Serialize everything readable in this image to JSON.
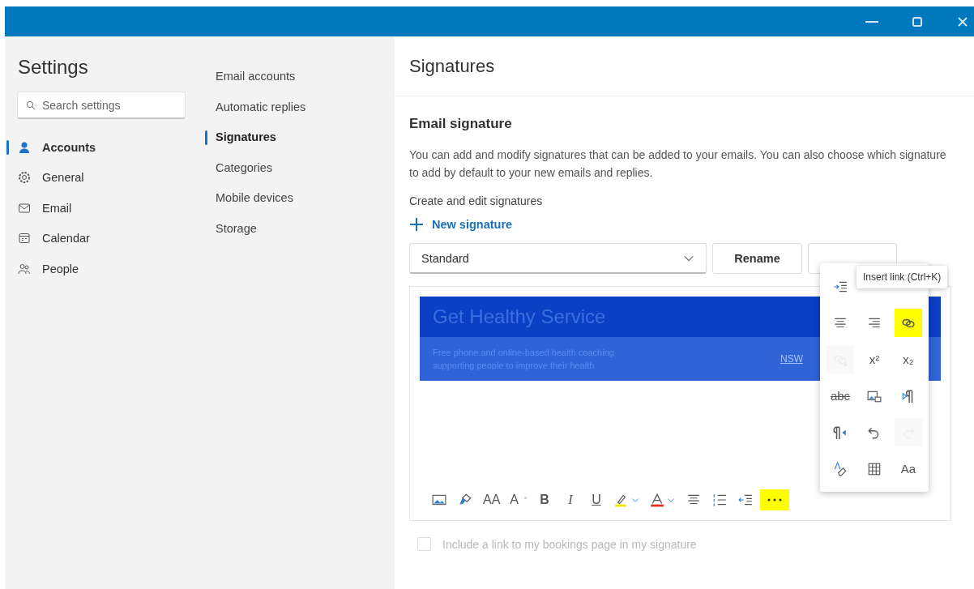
{
  "window": {
    "controls": [
      {
        "kind": "minimize"
      },
      {
        "kind": "maximize"
      },
      {
        "kind": "close"
      }
    ]
  },
  "settings": {
    "title": "Settings",
    "search": {
      "placeholder": "Search settings"
    },
    "nav": [
      {
        "label": "Accounts",
        "kind": "person",
        "selected": true
      },
      {
        "label": "General",
        "kind": "gear",
        "selected": false
      },
      {
        "label": "Email",
        "kind": "mail",
        "selected": false
      },
      {
        "label": "Calendar",
        "kind": "calendar",
        "selected": false
      },
      {
        "label": "People",
        "kind": "people",
        "selected": false
      }
    ]
  },
  "subnav": [
    {
      "label": "Email accounts",
      "selected": false
    },
    {
      "label": "Automatic replies",
      "selected": false
    },
    {
      "label": "Signatures",
      "selected": true
    },
    {
      "label": "Categories",
      "selected": false
    },
    {
      "label": "Mobile devices",
      "selected": false
    },
    {
      "label": "Storage",
      "selected": false
    }
  ],
  "content": {
    "title": "Signatures",
    "section": "Email signature",
    "description": "You can add and modify signatures that can be added to your emails. You can also choose which signature to add by default to your new emails and replies.",
    "create_label": "Create and edit signatures",
    "new_button": "New signature",
    "signature_select": {
      "value": "Standard"
    },
    "rename_button": "Rename",
    "banner": {
      "title": "Get Healthy Service",
      "subtitle": "Free phone and online-based health coaching supporting people to improve their health",
      "logo": "NSW"
    },
    "toolbar": [
      {
        "kind": "image",
        "highlighted": false
      },
      {
        "kind": "painter",
        "highlighted": false
      },
      {
        "kind": "text",
        "label": "AA",
        "highlighted": false
      },
      {
        "kind": "grow",
        "label": "A",
        "highlighted": false
      },
      {
        "kind": "bold",
        "label": "B",
        "highlighted": false
      },
      {
        "kind": "italic",
        "label": "I",
        "highlighted": false
      },
      {
        "kind": "underline",
        "label": "U",
        "highlighted": false
      },
      {
        "kind": "highlight",
        "highlighted": false
      },
      {
        "kind": "fontcolor",
        "highlighted": false
      },
      {
        "kind": "bullets",
        "highlighted": false
      },
      {
        "kind": "numbers",
        "highlighted": false
      },
      {
        "kind": "outdent",
        "highlighted": false
      },
      {
        "kind": "more",
        "highlighted": true
      }
    ],
    "bookings": {
      "label": "Include a link to my bookings page in my signature",
      "checked": false,
      "disabled": true
    }
  },
  "more_menu": {
    "items": [
      {
        "kind": "indent",
        "highlighted": false,
        "disabled": false
      },
      {
        "kind": "blank"
      },
      {
        "kind": "blank"
      },
      {
        "kind": "center",
        "highlighted": false,
        "disabled": false
      },
      {
        "kind": "right",
        "highlighted": false,
        "disabled": false
      },
      {
        "kind": "link",
        "highlighted": true,
        "disabled": false
      },
      {
        "kind": "unlink",
        "highlighted": false,
        "disabled": true
      },
      {
        "kind": "text",
        "label": "x²",
        "highlighted": false,
        "disabled": false
      },
      {
        "kind": "text",
        "label": "x₂",
        "highlighted": false,
        "disabled": false
      },
      {
        "kind": "strike",
        "label": "abc",
        "highlighted": false,
        "disabled": false
      },
      {
        "kind": "alttext",
        "highlighted": false,
        "disabled": false
      },
      {
        "kind": "ltr",
        "highlighted": false,
        "disabled": false
      },
      {
        "kind": "rtl",
        "highlighted": false,
        "disabled": false
      },
      {
        "kind": "undo",
        "highlighted": false,
        "disabled": false
      },
      {
        "kind": "redo",
        "highlighted": false,
        "disabled": true
      },
      {
        "kind": "clear",
        "highlighted": false,
        "disabled": false
      },
      {
        "kind": "table",
        "highlighted": false,
        "disabled": false
      },
      {
        "kind": "text",
        "label": "Aa",
        "highlighted": false,
        "disabled": false
      }
    ],
    "tooltip": "Insert link (Ctrl+K)"
  }
}
